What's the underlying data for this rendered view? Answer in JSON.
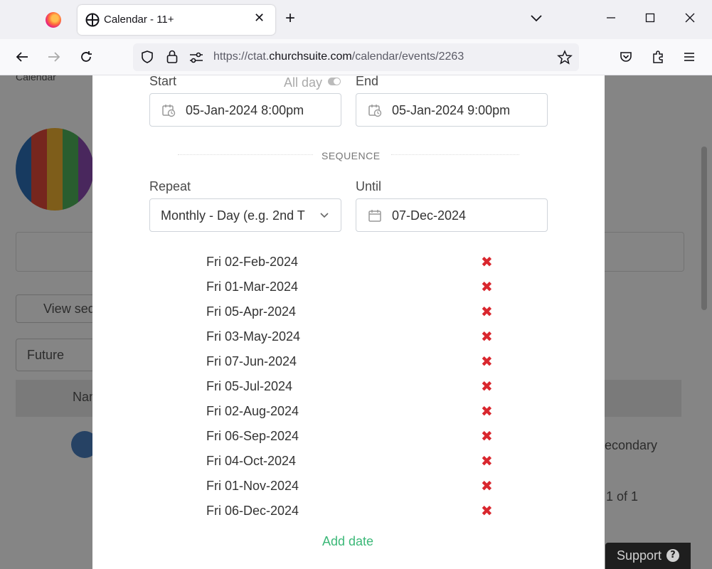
{
  "browser": {
    "tab_title": "Calendar - 11+",
    "tab_close": "✕",
    "new_tab": "+",
    "url_prefix": "https://ctat.",
    "url_domain": "churchsuite.com",
    "url_path": "/calendar/events/2263"
  },
  "background": {
    "nav_item": "Calendar",
    "view_sequence": "View seq",
    "filter_value": "Future",
    "column_name": "Nam",
    "row_tag": "econdary",
    "pagination": "1 of 1"
  },
  "modal": {
    "start_label": "Start",
    "all_day_label": "All day",
    "end_label": "End",
    "start_value": "05-Jan-2024 8:00pm",
    "end_value": "05-Jan-2024  9:00pm",
    "sequence_heading": "SEQUENCE",
    "repeat_label": "Repeat",
    "repeat_value": "Monthly - Day (e.g. 2nd T",
    "until_label": "Until",
    "until_value": "07-Dec-2024",
    "remove_symbol": "✖",
    "dates": [
      "Fri 02-Feb-2024",
      "Fri 01-Mar-2024",
      "Fri 05-Apr-2024",
      "Fri 03-May-2024",
      "Fri 07-Jun-2024",
      "Fri 05-Jul-2024",
      "Fri 02-Aug-2024",
      "Fri 06-Sep-2024",
      "Fri 04-Oct-2024",
      "Fri 01-Nov-2024",
      "Fri 06-Dec-2024"
    ],
    "add_date_label": "Add date"
  },
  "support": {
    "label": "Support",
    "icon_glyph": "?"
  },
  "colors": {
    "remove": "#d9272e",
    "add_link": "#3cb878"
  }
}
